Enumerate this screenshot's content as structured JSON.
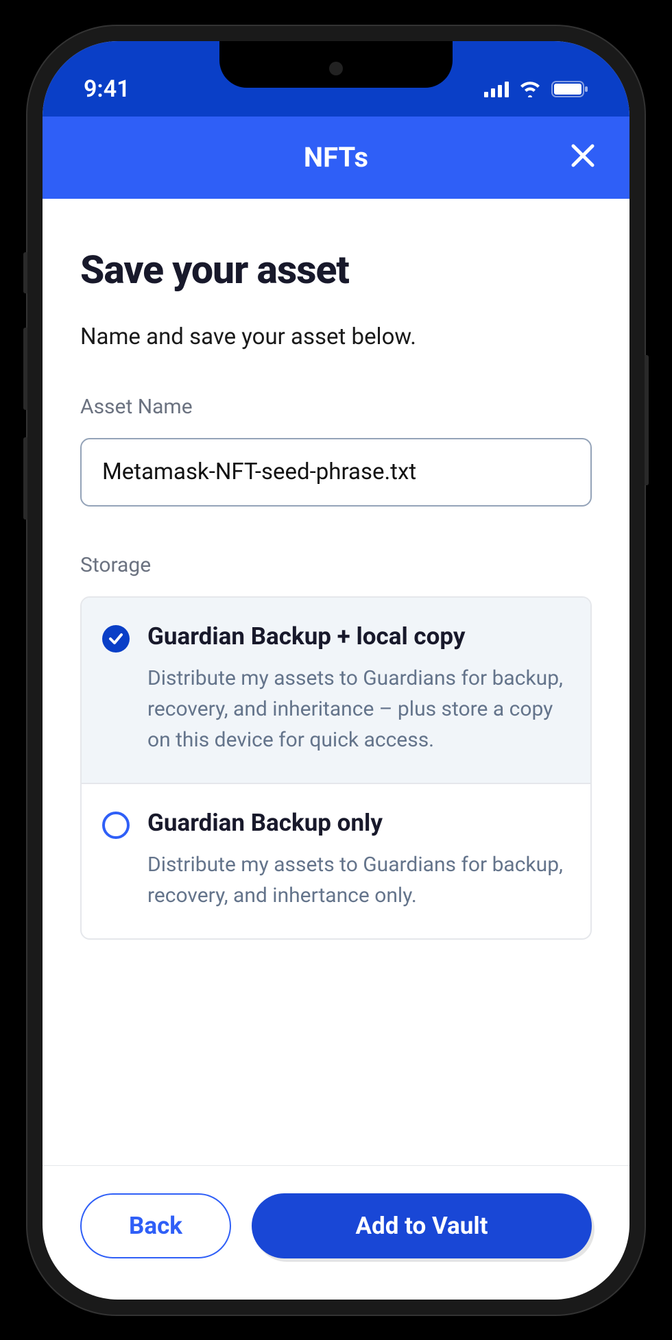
{
  "statusBar": {
    "time": "9:41"
  },
  "header": {
    "title": "NFTs"
  },
  "page": {
    "title": "Save your asset",
    "subtitle": "Name and save your asset below."
  },
  "assetName": {
    "label": "Asset Name",
    "value": "Metamask-NFT-seed-phrase.txt"
  },
  "storage": {
    "label": "Storage",
    "options": [
      {
        "title": "Guardian Backup + local copy",
        "description": "Distribute my assets to Guardians for backup, recovery, and inheritance – plus store a copy on this device for quick access.",
        "selected": true
      },
      {
        "title": "Guardian Backup only",
        "description": "Distribute my assets to Guardians for backup, recovery, and inhertance only.",
        "selected": false
      }
    ]
  },
  "footer": {
    "back": "Back",
    "primary": "Add to Vault"
  }
}
